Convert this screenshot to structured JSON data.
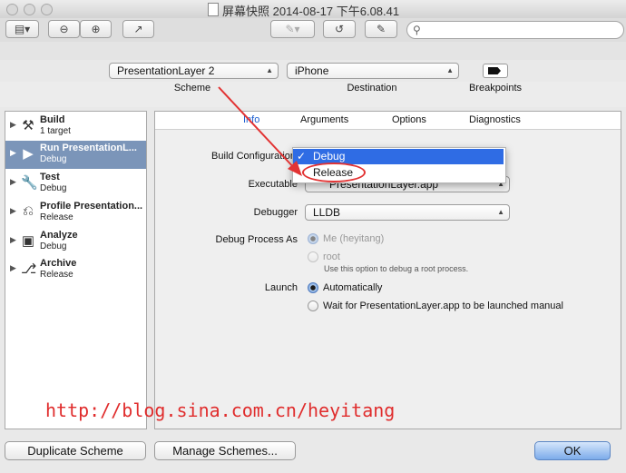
{
  "window": {
    "title": "屏幕快照 2014-08-17 下午6.08.41"
  },
  "toolbar": {
    "sidebar_toggle_icon": "sidebar-toggle-icon",
    "zoom_out_icon": "zoom-out-icon",
    "zoom_in_icon": "zoom-in-icon",
    "share_icon": "share-icon",
    "annotate_icon": "pen-icon",
    "rotate_icon": "rotate-icon",
    "edit_icon": "edit-icon",
    "search_placeholder": ""
  },
  "scheme_bar": {
    "scheme_value": "PresentationLayer 2",
    "scheme_caption": "Scheme",
    "destination_value": "iPhone",
    "destination_caption": "Destination",
    "breakpoints_caption": "Breakpoints"
  },
  "actions": [
    {
      "title": "Build",
      "subtitle": "1 target",
      "icon": "hammer-icon",
      "selected": false
    },
    {
      "title": "Run PresentationL...",
      "subtitle": "Debug",
      "icon": "run-icon",
      "selected": true
    },
    {
      "title": "Test",
      "subtitle": "Debug",
      "icon": "wrench-icon",
      "selected": false
    },
    {
      "title": "Profile Presentation...",
      "subtitle": "Release",
      "icon": "profile-icon",
      "selected": false
    },
    {
      "title": "Analyze",
      "subtitle": "Debug",
      "icon": "analyze-icon",
      "selected": false
    },
    {
      "title": "Archive",
      "subtitle": "Release",
      "icon": "archive-icon",
      "selected": false
    }
  ],
  "tabs": [
    "Info",
    "Arguments",
    "Options",
    "Diagnostics"
  ],
  "info": {
    "build_config_label": "Build Configuration",
    "executable_label": "Executable",
    "executable_value": "PresentationLayer.app",
    "debugger_label": "Debugger",
    "debugger_value": "LLDB",
    "debug_process_label": "Debug Process As",
    "me_option": "Me (heyitang)",
    "root_option": "root",
    "root_hint": "Use this option to debug a root process.",
    "launch_label": "Launch",
    "auto_option": "Automatically",
    "wait_option": "Wait for PresentationLayer.app to be launched manual"
  },
  "build_config_menu": {
    "options": [
      "Debug",
      "Release"
    ],
    "selected": "Debug",
    "checkmark": "✓"
  },
  "annotation": {
    "url": "http://blog.sina.com.cn/heyitang",
    "arrow_color": "#e23333"
  },
  "footer": {
    "duplicate_label": "Duplicate Scheme",
    "manage_label": "Manage Schemes...",
    "ok_label": "OK"
  },
  "colors": {
    "selection": "#7b95b9",
    "menu_highlight": "#2f6ce4",
    "active_tab": "#1c5fd1",
    "annotation": "#e02d2d"
  }
}
